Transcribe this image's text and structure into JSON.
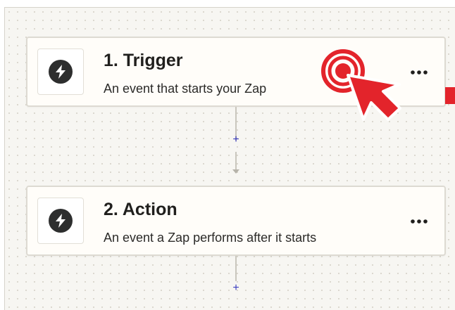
{
  "steps": [
    {
      "title": "1. Trigger",
      "description": "An event that starts your Zap",
      "icon": "bolt-icon",
      "menu_icon": "more-options-icon"
    },
    {
      "title": "2. Action",
      "description": "An event a Zap performs after it starts",
      "icon": "bolt-icon",
      "menu_icon": "more-options-icon"
    }
  ],
  "connectors": [
    {
      "add_label": "+"
    },
    {
      "add_label": "+"
    }
  ],
  "overlay": {
    "click_indicator": "click-target-icon",
    "pointer": "mouse-pointer-icon",
    "accent_color": "#e3242b"
  },
  "colors": {
    "canvas": "#f7f6f2",
    "card": "#fffdf9",
    "icon_fill": "#2d2e2e",
    "add_link": "#3b3dbf"
  }
}
